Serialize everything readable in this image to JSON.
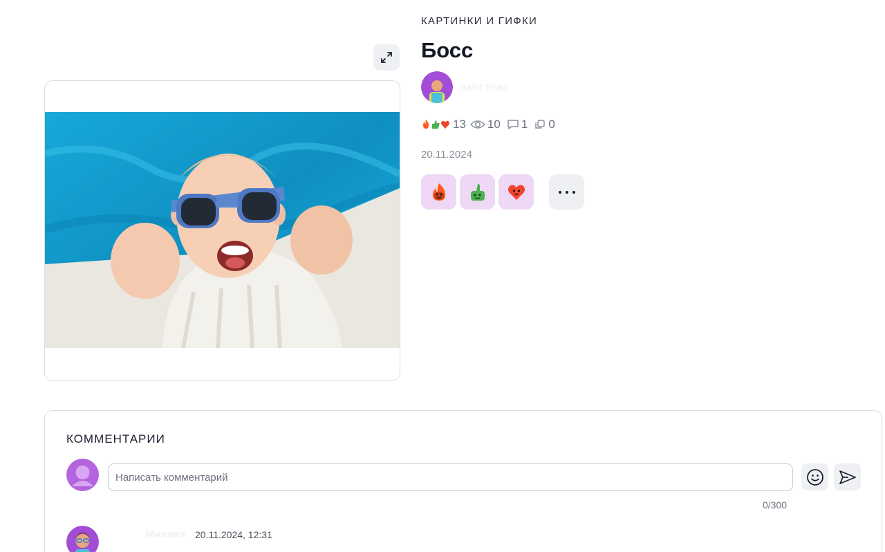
{
  "post": {
    "category": "КАРТИНКИ И ГИФКИ",
    "title": "Босс",
    "author_name": "Saint Boss",
    "date": "20.11.2024",
    "stats": {
      "reactions_count": "13",
      "views": "10",
      "comments": "1",
      "reposts": "0"
    },
    "reaction_buttons": [
      "fire-reaction",
      "thumbs-up-reaction",
      "heart-reaction"
    ]
  },
  "comments": {
    "title": "КОММЕНТАРИИ",
    "input_placeholder": "Написать комментарий",
    "input_value": "",
    "char_counter": "0/300",
    "items": [
      {
        "author": "Михаил",
        "date": "20.11.2024, 12:31"
      }
    ]
  },
  "colors": {
    "accent_reaction_bg": "#eed8f5",
    "button_bg": "#eef0f3",
    "border": "#dcdfe4",
    "fire": "#ff5a1f",
    "thumb": "#4caf50",
    "heart": "#f0442f",
    "avatar_purple": "#a34cd6"
  }
}
